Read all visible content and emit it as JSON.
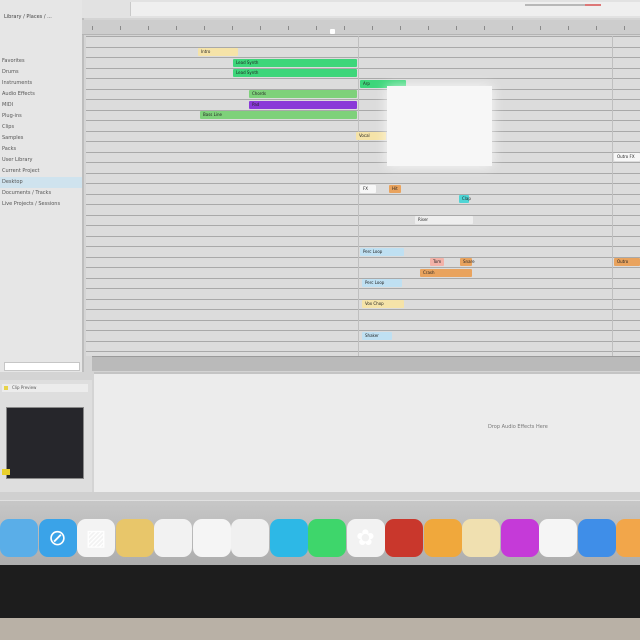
{
  "browser": {
    "header": "Library / Places / ...",
    "items": [
      {
        "label": "Favorites",
        "selected": false
      },
      {
        "label": "Drums",
        "selected": false
      },
      {
        "label": "Instruments",
        "selected": false
      },
      {
        "label": "Audio Effects",
        "selected": false
      },
      {
        "label": "MIDI",
        "selected": false
      },
      {
        "label": "Plug-ins",
        "selected": false
      },
      {
        "label": "Clips",
        "selected": false
      },
      {
        "label": "Samples",
        "selected": false
      },
      {
        "label": "Packs",
        "selected": false
      },
      {
        "label": "User Library",
        "selected": false
      },
      {
        "label": "Current Project",
        "selected": false
      },
      {
        "label": "Desktop",
        "selected": true
      },
      {
        "label": "Documents / Tracks",
        "selected": false
      },
      {
        "label": "Live Projects / Sessions",
        "selected": false
      }
    ]
  },
  "arrangement": {
    "clips": [
      {
        "label": "Intro",
        "color": "#f5e3a8",
        "track": 0,
        "start": 198,
        "width": 40
      },
      {
        "label": "Lead Synth",
        "color": "#3dd67a",
        "track": 1,
        "start": 233,
        "width": 124
      },
      {
        "label": "Lead Synth",
        "color": "#3dd67a",
        "track": 2,
        "start": 233,
        "width": 124
      },
      {
        "label": "Arp",
        "color": "#3dd67a",
        "track": 3,
        "start": 360,
        "width": 46
      },
      {
        "label": "Chords",
        "color": "#7ed17a",
        "track": 4,
        "start": 249,
        "width": 108
      },
      {
        "label": "Pad",
        "color": "#8a3ad8",
        "track": 5,
        "start": 249,
        "width": 108
      },
      {
        "label": "Bass Line",
        "color": "#7ed17a",
        "track": 6,
        "start": 200,
        "width": 157
      },
      {
        "label": "Vocal",
        "color": "#f5e3a8",
        "track": 8,
        "start": 356,
        "width": 30
      },
      {
        "label": "FX",
        "color": "#f7f7f7",
        "track": 13,
        "start": 360,
        "width": 16
      },
      {
        "label": "Hit",
        "color": "#e9a35e",
        "track": 13,
        "start": 389,
        "width": 12
      },
      {
        "label": "Clap",
        "color": "#4fd5d5",
        "track": 14,
        "start": 459,
        "width": 10
      },
      {
        "label": "Riser",
        "color": "#eeeeee",
        "track": 16,
        "start": 415,
        "width": 58
      },
      {
        "label": "Perc Loop",
        "color": "#bfe0f2",
        "track": 19,
        "start": 360,
        "width": 44
      },
      {
        "label": "Tom",
        "color": "#f3b2a8",
        "track": 20,
        "start": 430,
        "width": 14
      },
      {
        "label": "Snare",
        "color": "#e9a35e",
        "track": 20,
        "start": 460,
        "width": 12
      },
      {
        "label": "Crash",
        "color": "#e9a35e",
        "track": 21,
        "start": 420,
        "width": 52
      },
      {
        "label": "Perc Loop",
        "color": "#bfe0f2",
        "track": 22,
        "start": 362,
        "width": 40
      },
      {
        "label": "Vox Chop",
        "color": "#f5e3a8",
        "track": 24,
        "start": 362,
        "width": 42
      },
      {
        "label": "Shaker",
        "color": "#bfe0f2",
        "track": 27,
        "start": 362,
        "width": 30
      },
      {
        "label": "Outro",
        "color": "#e9a35e",
        "track": 20,
        "start": 614,
        "width": 26
      },
      {
        "label": "Outro FX",
        "color": "#f7f7f7",
        "track": 10,
        "start": 614,
        "width": 26
      }
    ]
  },
  "clip_panel": {
    "title": "Clip Preview"
  },
  "detail": {
    "hint": "Drop Audio Effects Here"
  },
  "dock": {
    "apps": [
      {
        "name": "finder",
        "icon": "finder-icon",
        "glyph": "",
        "color": "#5aaee8"
      },
      {
        "name": "safari",
        "icon": "compass-icon",
        "glyph": "⊘",
        "color": "#3aa3e8"
      },
      {
        "name": "preview",
        "icon": "preview-icon",
        "glyph": "▨",
        "color": "#f3f3f3"
      },
      {
        "name": "folder",
        "icon": "folder-icon",
        "glyph": "",
        "color": "#e8c66a"
      },
      {
        "name": "calendar",
        "icon": "calendar-icon",
        "glyph": "",
        "color": "#f2f2f2"
      },
      {
        "name": "notes",
        "icon": "notes-icon",
        "glyph": "",
        "color": "#f5f5f5"
      },
      {
        "name": "textedit",
        "icon": "document-icon",
        "glyph": "",
        "color": "#f0f0f0"
      },
      {
        "name": "messages",
        "icon": "chat-bubble-icon",
        "glyph": "",
        "color": "#2db8e6"
      },
      {
        "name": "facetime",
        "icon": "video-icon",
        "glyph": "",
        "color": "#3ed66b"
      },
      {
        "name": "photos",
        "icon": "photos-icon",
        "glyph": "✿",
        "color": "#f2f2f2"
      },
      {
        "name": "photo-booth",
        "icon": "photo-booth-icon",
        "glyph": "",
        "color": "#c9372c"
      },
      {
        "name": "garageband",
        "icon": "guitar-icon",
        "glyph": "",
        "color": "#f0a83c"
      },
      {
        "name": "sketch",
        "icon": "pencil-icon",
        "glyph": "",
        "color": "#f0e0b0"
      },
      {
        "name": "itunes",
        "icon": "music-note-icon",
        "glyph": "",
        "color": "#c53ad8"
      },
      {
        "name": "clock",
        "icon": "clock-icon",
        "glyph": "",
        "color": "#f5f5f5"
      },
      {
        "name": "keynote",
        "icon": "podium-icon",
        "glyph": "",
        "color": "#3f8ee8"
      },
      {
        "name": "pages",
        "icon": "pen-icon",
        "glyph": "",
        "color": "#f2a64a"
      }
    ]
  }
}
